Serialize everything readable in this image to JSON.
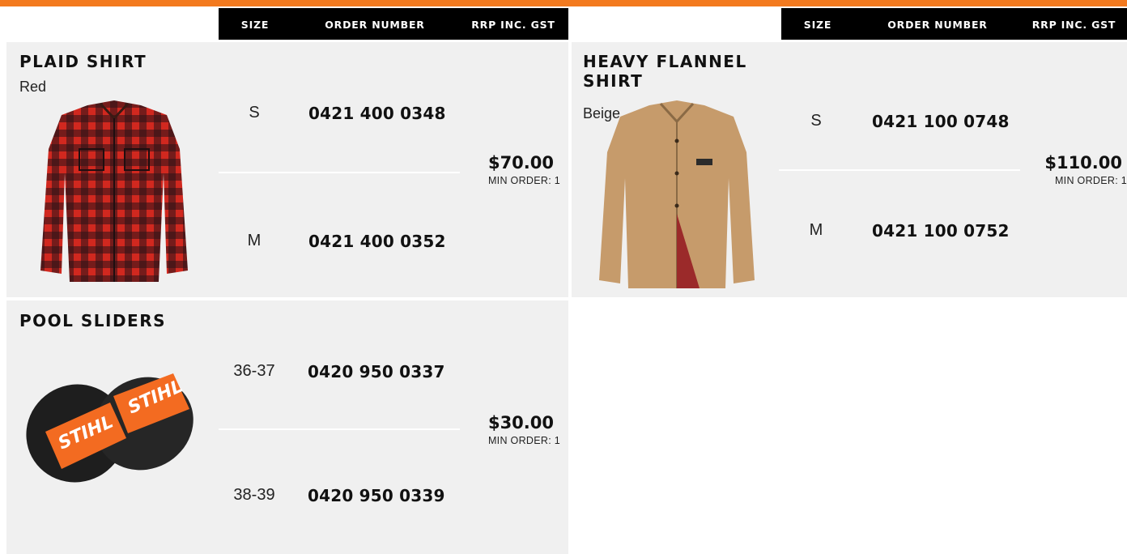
{
  "brand": {
    "accent": "#f37a1f"
  },
  "table_header": {
    "size": "SIZE",
    "order_number": "ORDER NUMBER",
    "rrp": "RRP INC. GST"
  },
  "products": [
    {
      "name": "PLAID SHIRT",
      "color": "Red",
      "image": "red-plaid-shirt-photo",
      "rows": [
        {
          "size": "S",
          "order": "0421 400 0348"
        },
        {
          "size": "M",
          "order": "0421 400 0352"
        }
      ],
      "price": "$70.00",
      "min_order": "MIN ORDER: 1"
    },
    {
      "name": "HEAVY FLANNEL SHIRT",
      "color": "Beige",
      "image": "beige-flannel-shirt-photo",
      "rows": [
        {
          "size": "S",
          "order": "0421 100 0748"
        },
        {
          "size": "M",
          "order": "0421 100 0752"
        }
      ],
      "price": "$110.00",
      "min_order": "MIN ORDER: 1"
    },
    {
      "name": "POOL SLIDERS",
      "color": "",
      "image": "stihl-pool-sliders-photo",
      "rows": [
        {
          "size": "36-37",
          "order": "0420 950 0337"
        },
        {
          "size": "38-39",
          "order": "0420 950 0339"
        }
      ],
      "price": "$30.00",
      "min_order": "MIN ORDER: 1"
    }
  ]
}
